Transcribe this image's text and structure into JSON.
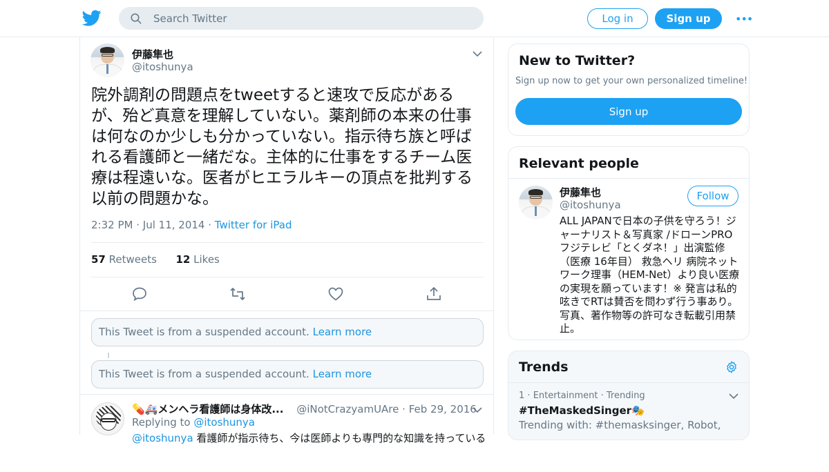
{
  "header": {
    "search_placeholder": "Search Twitter",
    "login_label": "Log in",
    "signup_label": "Sign up",
    "more_label": "•••"
  },
  "tweet": {
    "name": "伊藤隼也",
    "handle": "@itoshunya",
    "text": "院外調剤の問題点をtweetすると速攻で反応があるが、殆ど真意を理解していない。薬剤師の本来の仕事は何なのか少しも分かっていない。指示待ち族と呼ばれる看護師と一緒だな。主体的に仕事をするチーム医療は程遠いな。医者がヒエラルキーの頂点を批判する以前の問題かな。",
    "time": "2:32 PM",
    "date": "Jul 11, 2014",
    "source": "Twitter for iPad",
    "retweets_count": "57",
    "retweets_label": "Retweets",
    "likes_count": "12",
    "likes_label": "Likes"
  },
  "suspended": {
    "text": "This Tweet is from a suspended account.",
    "link": "Learn more"
  },
  "reply": {
    "name": "💊🚑メンヘラ看護師は身体改...",
    "handle": "@iNotCrazyamUAre",
    "date": "Feb 29, 2016",
    "replying_label": "Replying to",
    "replying_handle": "@itoshunya",
    "text_mention": "@itoshunya",
    "text_rest": " 看護師が指示待ち、今は医師よりも専門的な知識を持っている認"
  },
  "new_to_twitter": {
    "title": "New to Twitter?",
    "subtitle": "Sign up now to get your own personalized timeline!",
    "button": "Sign up"
  },
  "relevant": {
    "title": "Relevant people",
    "name": "伊藤隼也",
    "handle": "@itoshunya",
    "follow": "Follow",
    "bio": "ALL JAPANで日本の子供を守ろう！ジャーナリスト＆写真家 /ドローンPRO フジテレビ「とくダネ！」出演監修（医療 16年目） 救急ヘリ 病院ネットワーク理事（HEM-Net）より良い医療の実現を願っています！※ 発言は私的呟きでRTは賛否を問わず行う事あり。写真、著作物等の許可なき転載引用禁止。"
  },
  "trends": {
    "title": "Trends",
    "item": {
      "rank": "1",
      "category": "Entertainment",
      "status": "Trending",
      "name": "#TheMaskedSinger",
      "with": "Trending with: #themasksinger, Robot,"
    }
  },
  "colors": {
    "accent": "#1da1f2",
    "text": "#14171a",
    "muted": "#657786",
    "border": "#e6ecf0"
  }
}
